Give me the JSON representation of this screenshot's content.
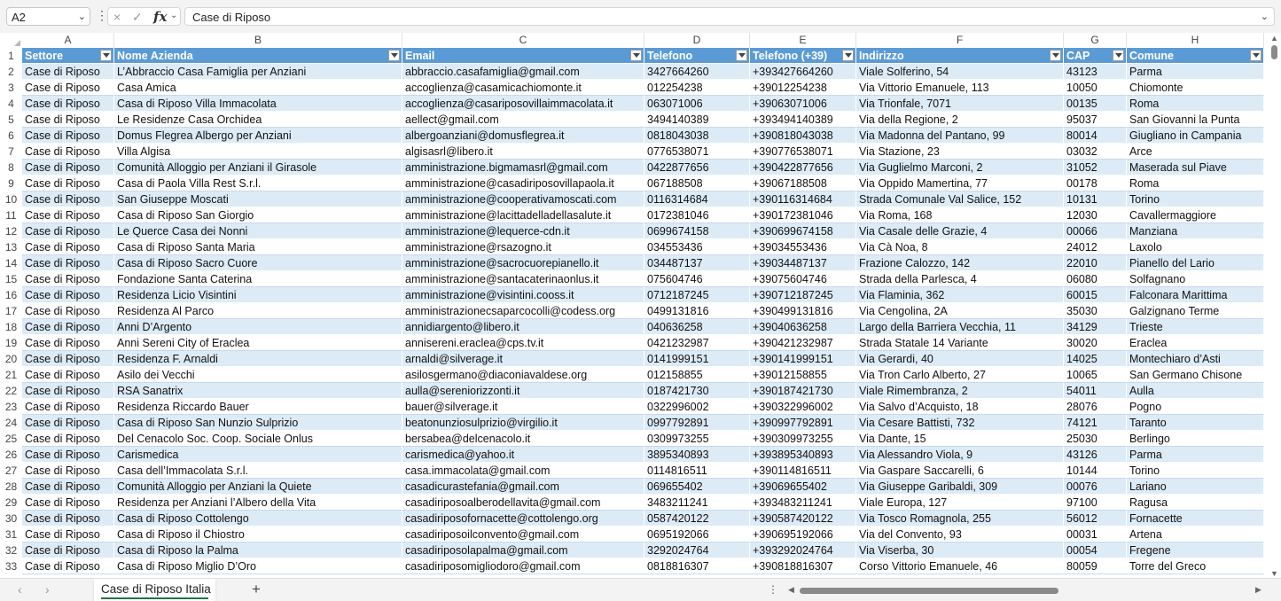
{
  "formula_bar": {
    "name_box": "A2",
    "formula": "Case di Riposo"
  },
  "columns": [
    {
      "letter": "A",
      "header": "Settore"
    },
    {
      "letter": "B",
      "header": "Nome Azienda"
    },
    {
      "letter": "C",
      "header": "Email"
    },
    {
      "letter": "D",
      "header": "Telefono"
    },
    {
      "letter": "E",
      "header": "Telefono (+39)"
    },
    {
      "letter": "F",
      "header": "Indirizzo"
    },
    {
      "letter": "G",
      "header": "CAP"
    },
    {
      "letter": "H",
      "header": "Comune"
    }
  ],
  "header_row_number": "1",
  "rows": [
    {
      "n": "2",
      "cells": [
        "Case di Riposo",
        "L’Abbraccio Casa Famiglia per Anziani",
        "abbraccio.casafamiglia@gmail.com",
        "3427664260",
        "+393427664260",
        "Viale Solferino, 54",
        "43123",
        "Parma"
      ]
    },
    {
      "n": "3",
      "cells": [
        "Case di Riposo",
        "Casa Amica",
        "accoglienza@casamicachiomonte.it",
        "012254238",
        "+39012254238",
        "Via Vittorio Emanuele, 113",
        "10050",
        "Chiomonte"
      ]
    },
    {
      "n": "4",
      "cells": [
        "Case di Riposo",
        "Casa di Riposo Villa Immacolata",
        "accoglienza@casariposovillaimmacolata.it",
        "063071006",
        "+39063071006",
        "Via Trionfale, 7071",
        "00135",
        "Roma"
      ]
    },
    {
      "n": "5",
      "cells": [
        "Case di Riposo",
        "Le Residenze Casa Orchidea",
        "aellect@gmail.com",
        "3494140389",
        "+393494140389",
        "Via della Regione, 2",
        "95037",
        "San Giovanni la Punta"
      ]
    },
    {
      "n": "6",
      "cells": [
        "Case di Riposo",
        "Domus Flegrea Albergo per Anziani",
        "albergoanziani@domusflegrea.it",
        "0818043038",
        "+390818043038",
        "Via Madonna del Pantano, 99",
        "80014",
        "Giugliano in Campania"
      ]
    },
    {
      "n": "7",
      "cells": [
        "Case di Riposo",
        "Villa Algisa",
        "algisasrl@libero.it",
        "0776538071",
        "+390776538071",
        "Via Stazione, 23",
        "03032",
        "Arce"
      ]
    },
    {
      "n": "8",
      "cells": [
        "Case di Riposo",
        "Comunità Alloggio per Anziani il Girasole",
        "amministrazione.bigmamasrl@gmail.com",
        "0422877656",
        "+390422877656",
        "Via Guglielmo Marconi, 2",
        "31052",
        "Maserada sul Piave"
      ]
    },
    {
      "n": "9",
      "cells": [
        "Case di Riposo",
        "Casa di Paola Villa Rest S.r.l.",
        "amministrazione@casadiriposovillapaola.it",
        "067188508",
        "+39067188508",
        "Via Oppido Mamertina, 77",
        "00178",
        "Roma"
      ]
    },
    {
      "n": "10",
      "cells": [
        "Case di Riposo",
        "San Giuseppe Moscati",
        "amministrazione@cooperativamoscati.com",
        "0116314684",
        "+390116314684",
        "Strada Comunale Val Salice, 152",
        "10131",
        "Torino"
      ]
    },
    {
      "n": "11",
      "cells": [
        "Case di Riposo",
        "Casa di Riposo San Giorgio",
        "amministrazione@lacittadelladellasalute.it",
        "0172381046",
        "+390172381046",
        "Via Roma, 168",
        "12030",
        "Cavallermaggiore"
      ]
    },
    {
      "n": "12",
      "cells": [
        "Case di Riposo",
        "Le Querce Casa dei Nonni",
        "amministrazione@lequerce-cdn.it",
        "0699674158",
        "+390699674158",
        "Via Casale delle Grazie, 4",
        "00066",
        "Manziana"
      ]
    },
    {
      "n": "13",
      "cells": [
        "Case di Riposo",
        "Casa di Riposo Santa Maria",
        "amministrazione@rsazogno.it",
        "034553436",
        "+39034553436",
        "Via Cà Noa, 8",
        "24012",
        "Laxolo"
      ]
    },
    {
      "n": "14",
      "cells": [
        "Case di Riposo",
        "Casa di Riposo Sacro Cuore",
        "amministrazione@sacrocuorepianello.it",
        "034487137",
        "+39034487137",
        "Frazione Calozzo, 142",
        "22010",
        "Pianello del Lario"
      ]
    },
    {
      "n": "15",
      "cells": [
        "Case di Riposo",
        "Fondazione Santa Caterina",
        "amministrazione@santacaterinaonlus.it",
        "075604746",
        "+39075604746",
        "Strada della Parlesca, 4",
        "06080",
        "Solfagnano"
      ]
    },
    {
      "n": "16",
      "cells": [
        "Case di Riposo",
        "Residenza Licio Visintini",
        "amministrazione@visintini.cooss.it",
        "0712187245",
        "+390712187245",
        "Via Flaminia, 362",
        "60015",
        "Falconara Marittima"
      ]
    },
    {
      "n": "17",
      "cells": [
        "Case di Riposo",
        "Residenza Al Parco",
        "amministrazionecsaparcocolli@codess.org",
        "0499131816",
        "+390499131816",
        "Via Cengolina, 2A",
        "35030",
        "Galzignano Terme"
      ]
    },
    {
      "n": "18",
      "cells": [
        "Case di Riposo",
        "Anni D’Argento",
        "annidiargento@libero.it",
        "040636258",
        "+39040636258",
        "Largo della Barriera Vecchia, 11",
        "34129",
        "Trieste"
      ]
    },
    {
      "n": "19",
      "cells": [
        "Case di Riposo",
        "Anni Sereni City of Eraclea",
        "annisereni.eraclea@cps.tv.it",
        "0421232987",
        "+390421232987",
        "Strada Statale 14 Variante",
        "30020",
        "Eraclea"
      ]
    },
    {
      "n": "20",
      "cells": [
        "Case di Riposo",
        "Residenza F. Arnaldi",
        "arnaldi@silverage.it",
        "0141999151",
        "+390141999151",
        "Via Gerardi, 40",
        "14025",
        "Montechiaro d’Asti"
      ]
    },
    {
      "n": "21",
      "cells": [
        "Case di Riposo",
        "Asilo dei Vecchi",
        "asilosgermano@diaconiavaldese.org",
        "012158855",
        "+39012158855",
        "Via Tron Carlo Alberto, 27",
        "10065",
        "San Germano Chisone"
      ]
    },
    {
      "n": "22",
      "cells": [
        "Case di Riposo",
        "RSA Sanatrix",
        "aulla@serenioriz­zonti.it",
        "0187421730",
        "+390187421730",
        "Viale Rimembranza, 2",
        "54011",
        "Aulla"
      ]
    },
    {
      "n": "23",
      "cells": [
        "Case di Riposo",
        "Residenza Riccardo Bauer",
        "bauer@silverage.it",
        "0322996002",
        "+390322996002",
        "Via Salvo d’Acquisto, 18",
        "28076",
        "Pogno"
      ]
    },
    {
      "n": "24",
      "cells": [
        "Case di Riposo",
        "Casa di Riposo San Nunzio Sulprizio",
        "beatonunziosulprizio@virgilio.it",
        "0997792891",
        "+390997792891",
        "Via Cesare Battisti, 732",
        "74121",
        "Taranto"
      ]
    },
    {
      "n": "25",
      "cells": [
        "Case di Riposo",
        "Del Cenacolo Soc. Coop. Sociale Onlus",
        "bersabea@delcenacolo.it",
        "0309973255",
        "+390309973255",
        "Via Dante, 15",
        "25030",
        "Berlingo"
      ]
    },
    {
      "n": "26",
      "cells": [
        "Case di Riposo",
        "Carismedica",
        "carismedica@yahoo.it",
        "3895340893",
        "+393895340893",
        "Via Alessandro Viola, 9",
        "43126",
        "Parma"
      ]
    },
    {
      "n": "27",
      "cells": [
        "Case di Riposo",
        "Casa dell’Immacolata S.r.l.",
        "casa.immacolata@gmail.com",
        "0114816511",
        "+390114816511",
        "Via Gaspare Saccarelli, 6",
        "10144",
        "Torino"
      ]
    },
    {
      "n": "28",
      "cells": [
        "Case di Riposo",
        "Comunità Alloggio per Anziani la Quiete",
        "casadicurastefania@gmail.com",
        "069655402",
        "+39069655402",
        "Via Giuseppe Garibaldi, 309",
        "00076",
        "Lariano"
      ]
    },
    {
      "n": "29",
      "cells": [
        "Case di Riposo",
        "Residenza per Anziani l’Albero della Vita",
        "casadiriposoalberodellavita@gmail.com",
        "3483211241",
        "+393483211241",
        "Viale Europa, 127",
        "97100",
        "Ragusa"
      ]
    },
    {
      "n": "30",
      "cells": [
        "Case di Riposo",
        "Casa di Riposo Cottolengo",
        "casadiriposofornacette@cottolengo.org",
        "0587420122",
        "+390587420122",
        "Via Tosco Romagnola, 255",
        "56012",
        "Fornacette"
      ]
    },
    {
      "n": "31",
      "cells": [
        "Case di Riposo",
        "Casa di Riposo il Chiostro",
        "casadiriposoilconvento@gmail.com",
        "0695192066",
        "+390695192066",
        "Via del Convento, 93",
        "00031",
        "Artena"
      ]
    },
    {
      "n": "32",
      "cells": [
        "Case di Riposo",
        "Casa di Riposo la Palma",
        "casadiriposolapalma@gmail.com",
        "3292024764",
        "+393292024764",
        "Via Viserba, 30",
        "00054",
        "Fregene"
      ]
    },
    {
      "n": "33",
      "cells": [
        "Case di Riposo",
        "Casa di Riposo Miglio D’Oro",
        "casadiriposomigliodoro@gmail.com",
        "0818816307",
        "+390818816307",
        "Corso Vittorio Emanuele, 46",
        "80059",
        "Torre del Greco"
      ]
    }
  ],
  "sheet_tab": "Case di Riposo Italia",
  "icons": {
    "cancel": "×",
    "confirm": "✓",
    "function": "fx"
  },
  "colors": {
    "header_fill": "#5b9bd5",
    "band_fill": "#ddebf7",
    "active_tab_accent": "#217346"
  }
}
